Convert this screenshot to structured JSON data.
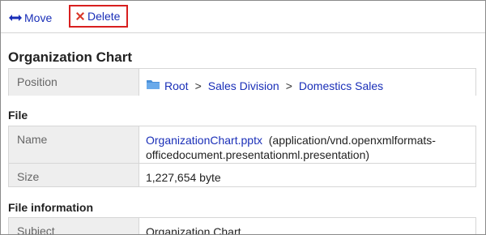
{
  "toolbar": {
    "move_label": "Move",
    "delete_label": "Delete"
  },
  "title": "Organization Chart",
  "position": {
    "label": "Position",
    "crumbs": [
      "Root",
      "Sales Division",
      "Domestics Sales"
    ],
    "separator": ">"
  },
  "file": {
    "section_label": "File",
    "name_label": "Name",
    "file_name": "OrganizationChart.pptx",
    "mime": "(application/vnd.openxmlformats-officedocument.presentationml.presentation)",
    "size_label": "Size",
    "size_value": "1,227,654 byte"
  },
  "file_info": {
    "section_label": "File information",
    "subject_label": "Subject",
    "subject_value": "Organization Chart"
  },
  "colors": {
    "link": "#1a2fb8",
    "delete_highlight": "#d81f1f",
    "label_bg": "#eeeeee"
  },
  "icons": {
    "move": "move-arrows-icon",
    "delete": "delete-x-icon",
    "folder": "folder-icon"
  }
}
